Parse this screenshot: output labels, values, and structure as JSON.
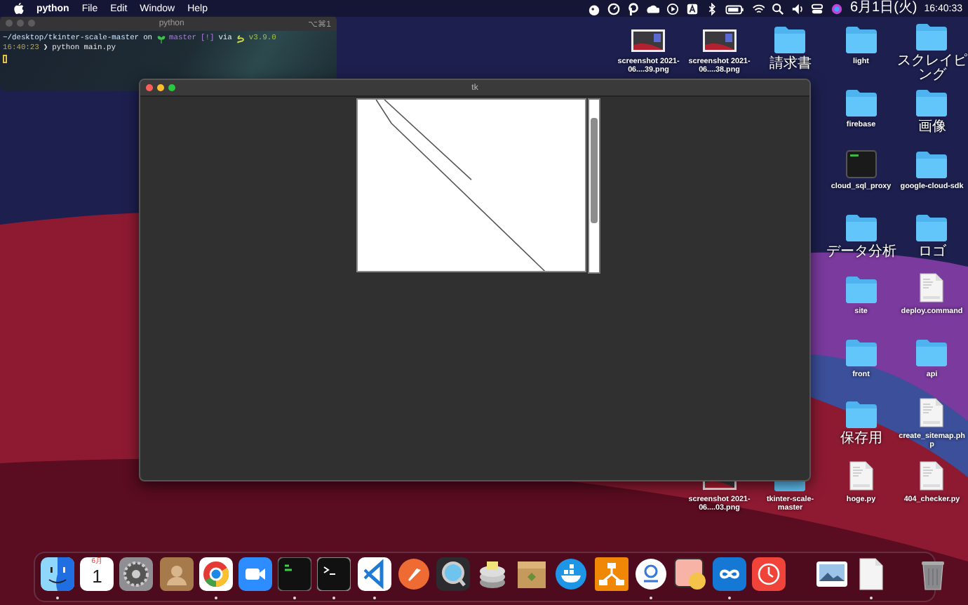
{
  "menu_bar": {
    "app_name": "python",
    "menus": [
      "File",
      "Edit",
      "Window",
      "Help"
    ],
    "date": "6月1日(火)",
    "time": "16:40:33"
  },
  "terminal": {
    "title": "python",
    "shortcut": "⌥⌘1",
    "lines": [
      [
        {
          "kind": "path",
          "text": "~/desktop/tkinter-scale-master"
        },
        {
          "kind": "word",
          "text": "on"
        },
        {
          "kind": "branch-icon"
        },
        {
          "kind": "branch",
          "text": "master"
        },
        {
          "kind": "status",
          "text": "[!]"
        },
        {
          "kind": "word",
          "text": "via"
        },
        {
          "kind": "python-icon"
        },
        {
          "kind": "version",
          "text": "v3.9.0"
        }
      ],
      [
        {
          "kind": "time",
          "text": "16:40:23"
        },
        {
          "kind": "prompt",
          "text": "❯"
        },
        {
          "kind": "command",
          "text": "python main.py"
        }
      ],
      [
        {
          "kind": "cursor"
        }
      ]
    ]
  },
  "tk_window": {
    "title": "tk"
  },
  "desktop_icons": [
    {
      "label": "screenshot 2021-06....39.png",
      "kind": "image"
    },
    {
      "label": "screenshot 2021-06....38.png",
      "kind": "image"
    },
    {
      "label": "請求書",
      "kind": "folder"
    },
    {
      "label": "light",
      "kind": "folder"
    },
    {
      "label": "スクレイピング",
      "kind": "folder"
    },
    {
      "label": "firebase",
      "kind": "folder"
    },
    {
      "label": "画像",
      "kind": "folder"
    },
    {
      "label": "cloud_sql_proxy",
      "kind": "executable"
    },
    {
      "label": "google-cloud-sdk",
      "kind": "folder"
    },
    {
      "label": "データ分析",
      "kind": "folder"
    },
    {
      "label": "ロゴ",
      "kind": "folder"
    },
    {
      "label": "site",
      "kind": "folder"
    },
    {
      "label": "deploy.command",
      "kind": "document"
    },
    {
      "label": "front",
      "kind": "folder"
    },
    {
      "label": "api",
      "kind": "folder"
    },
    {
      "label": "保存用",
      "kind": "folder"
    },
    {
      "label": "create_sitemap.php",
      "kind": "document"
    },
    {
      "label": "screenshot 2021-06....03.png",
      "kind": "image"
    },
    {
      "label": "tkinter-scale-master",
      "kind": "folder"
    },
    {
      "label": "hoge.py",
      "kind": "document"
    },
    {
      "label": "404_checker.py",
      "kind": "document"
    }
  ],
  "dock": {
    "sections": [
      {
        "items": [
          {
            "kind": "finder",
            "running": true
          },
          {
            "kind": "calendar",
            "running": false,
            "month": "6月",
            "day": "1"
          },
          {
            "kind": "settings",
            "running": false
          },
          {
            "kind": "contacts",
            "running": false
          },
          {
            "kind": "browser",
            "running": true
          },
          {
            "kind": "video",
            "running": false
          },
          {
            "kind": "terminal-green",
            "running": true
          },
          {
            "kind": "terminal",
            "running": true
          },
          {
            "kind": "editor",
            "running": true
          },
          {
            "kind": "rocket",
            "running": false
          },
          {
            "kind": "lens",
            "running": false
          },
          {
            "kind": "database",
            "running": false
          },
          {
            "kind": "archive",
            "running": false
          },
          {
            "kind": "whale",
            "running": false
          },
          {
            "kind": "diagram",
            "running": false
          },
          {
            "kind": "ring",
            "running": true
          },
          {
            "kind": "pill",
            "running": false
          },
          {
            "kind": "infinity",
            "running": true
          },
          {
            "kind": "clock",
            "running": false
          }
        ]
      },
      {
        "items": [
          {
            "kind": "photo",
            "running": false
          },
          {
            "kind": "document",
            "running": true
          }
        ]
      },
      {
        "items": [
          {
            "kind": "trash",
            "running": false
          }
        ]
      }
    ]
  }
}
